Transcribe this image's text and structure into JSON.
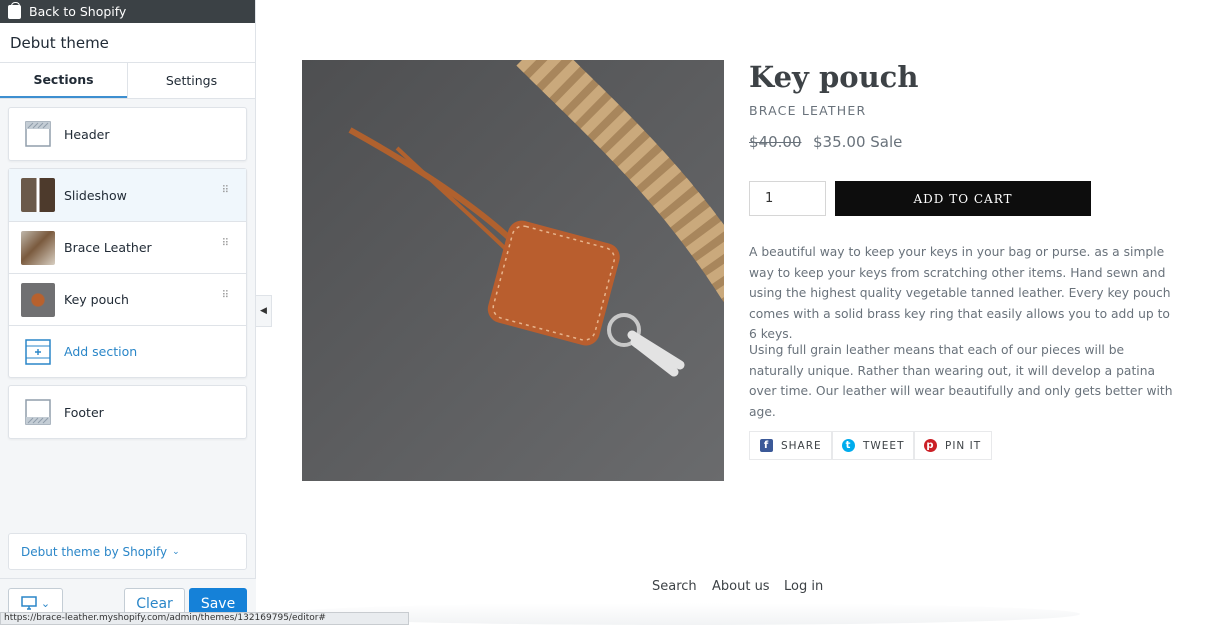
{
  "topbar": {
    "back_label": "Back to Shopify"
  },
  "sidebar": {
    "theme_name": "Debut theme",
    "tabs": [
      {
        "label": "Sections"
      },
      {
        "label": "Settings"
      }
    ],
    "header_item": {
      "label": "Header"
    },
    "sections": [
      {
        "label": "Slideshow"
      },
      {
        "label": "Brace Leather"
      },
      {
        "label": "Key pouch"
      }
    ],
    "add_section_label": "Add section",
    "footer_item": {
      "label": "Footer"
    },
    "theme_credit": "Debut theme by Shopify",
    "actions": {
      "clear": "Clear",
      "save": "Save"
    }
  },
  "status_url": "https://brace-leather.myshopify.com/admin/themes/132169795/editor#",
  "product": {
    "title": "Key pouch",
    "vendor": "BRACE LEATHER",
    "price_original": "$40.00",
    "price_sale": "$35.00 Sale",
    "quantity": "1",
    "add_to_cart": "ADD TO CART",
    "description_1": "A beautiful way to keep your keys in your bag or purse.  as a simple way to keep your keys from scratching other items. Hand sewn and using the highest quality vegetable tanned leather. Every key pouch comes with a solid brass key ring that easily allows you to add up to 6 keys.",
    "description_2": "Using full grain leather means that each of our pieces will be naturally unique. Rather than wearing out, it will develop a patina over time. Our leather will wear beautifully and only gets better with age.",
    "share": [
      {
        "label": "SHARE"
      },
      {
        "label": "TWEET"
      },
      {
        "label": "PIN IT"
      }
    ]
  },
  "footer_nav": [
    {
      "label": "Search"
    },
    {
      "label": "About us"
    },
    {
      "label": "Log in"
    }
  ],
  "colors": {
    "accent": "#2a86c8",
    "save": "#1581d8",
    "atc": "#0d0d0d",
    "facebook": "#3b5998",
    "twitter": "#00aced",
    "pinterest": "#cb2027"
  }
}
